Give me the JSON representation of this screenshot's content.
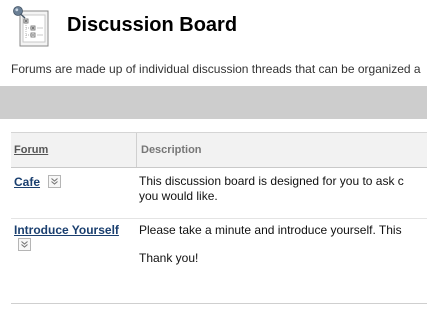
{
  "header": {
    "icon": "discussion-board-icon",
    "title": "Discussion Board",
    "description": "Forums are made up of individual discussion threads that can be organized a"
  },
  "table": {
    "columns": {
      "forum": "Forum",
      "description": "Description"
    },
    "rows": [
      {
        "name": "Cafe",
        "description_lines": [
          "This discussion board is designed for you to ask c",
          "you would like."
        ]
      },
      {
        "name": "Introduce Yourself",
        "description_lines": [
          "Please take a minute and introduce yourself.  This",
          "Thank you!"
        ]
      }
    ]
  }
}
